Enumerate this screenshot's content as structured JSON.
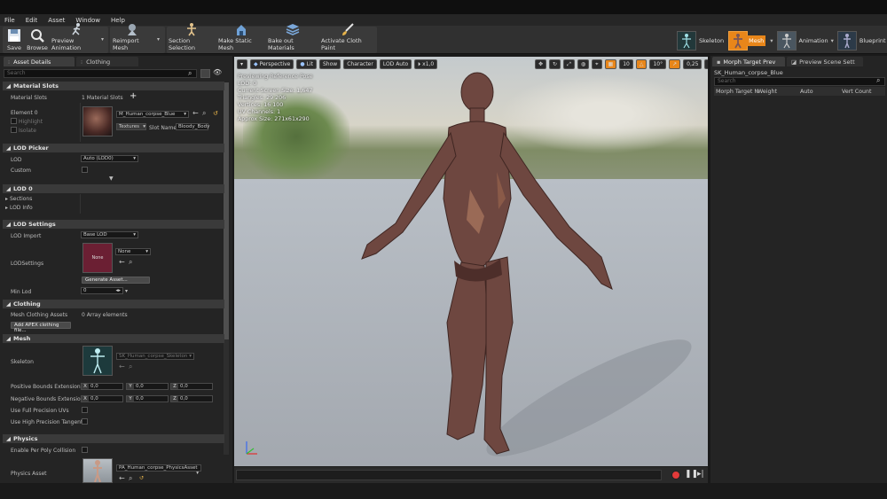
{
  "menu": [
    "File",
    "Edit",
    "Asset",
    "Window",
    "Help"
  ],
  "toolbar": {
    "save": "Save",
    "browse": "Browse",
    "preview_animation": "Preview Animation",
    "reimport_mesh": "Reimport Mesh",
    "section_selection": "Section Selection",
    "make_static_mesh": "Make Static Mesh",
    "bake_out_materials": "Bake out Materials",
    "activate_cloth_paint": "Activate Cloth Paint"
  },
  "modes": {
    "skeleton": "Skeleton",
    "mesh": "Mesh",
    "animation": "Animation",
    "blueprint": "Blueprint"
  },
  "left": {
    "tabs": [
      "Asset Details",
      "Clothing"
    ],
    "search_placeholder": "Search",
    "material_slots": {
      "header": "Material Slots",
      "label": "Material Slots",
      "count": "1 Material Slots",
      "element": "Element 0",
      "highlight": "Highlight",
      "isolate": "Isolate",
      "material": "M_Human_corpse_Blue",
      "textures": "Textures",
      "slot_name_label": "Slot Name",
      "slot_name": "Bloody_Body"
    },
    "lod_picker": {
      "header": "LOD Picker",
      "lod_label": "LOD",
      "lod_value": "Auto (LOD0)",
      "custom": "Custom"
    },
    "lod0": {
      "header": "LOD 0",
      "sections": "Sections",
      "lod_info": "LOD Info"
    },
    "lod_settings": {
      "header": "LOD Settings",
      "lod_import": "LOD Import",
      "lod_import_value": "Base LOD",
      "lodsettings": "LODSettings",
      "none_thumb": "None",
      "none_value": "None",
      "generate": "Generate Asset...",
      "min_lod": "Min Lod",
      "min_lod_value": "0"
    },
    "clothing": {
      "header": "Clothing",
      "mesh_clothing": "Mesh Clothing Assets",
      "array": "0 Array elements",
      "add_apex": "Add APEX clothing file..."
    },
    "mesh": {
      "header": "Mesh",
      "skeleton": "Skeleton",
      "skeleton_value": "SK_Human_corpse_Skeleton",
      "pos_bounds": "Positive Bounds Extension",
      "neg_bounds": "Negative Bounds Extension",
      "x": "X",
      "y": "Y",
      "z": "Z",
      "zero": "0,0",
      "full_uv": "Use Full Precision UVs",
      "high_tangent": "Use High Precision Tangent B"
    },
    "physics": {
      "header": "Physics",
      "per_poly": "Enable Per Poly Collision",
      "physics_asset": "Physics Asset",
      "physics_value": "PA_Human_corpse_PhysicsAsset"
    }
  },
  "viewport": {
    "perspective": "Perspective",
    "lit": "Lit",
    "show": "Show",
    "character": "Character",
    "lod_auto": "LOD Auto",
    "speed": "x1,0",
    "grid": "10",
    "angle": "10°",
    "scale": "0,25",
    "cam": "4",
    "stats": [
      "Previewing Reference Pose",
      "LOD: 0",
      "Current Screen Size: 1,647",
      "Triangles: 29 206",
      "Vertices: 16 100",
      "UV Channels: 1",
      "Approx Size: 271x61x290"
    ]
  },
  "right": {
    "tabs": [
      "Morph Target Prev",
      "Preview Scene Sett"
    ],
    "mesh_name": "SK_Human_corpse_Blue",
    "search_placeholder": "Search",
    "cols": [
      "Morph Target N",
      "Weight",
      "Auto",
      "Vert Count"
    ]
  },
  "colors": {
    "accent": "#e8861a",
    "panel": "#242424",
    "section": "#3a3a3a"
  }
}
